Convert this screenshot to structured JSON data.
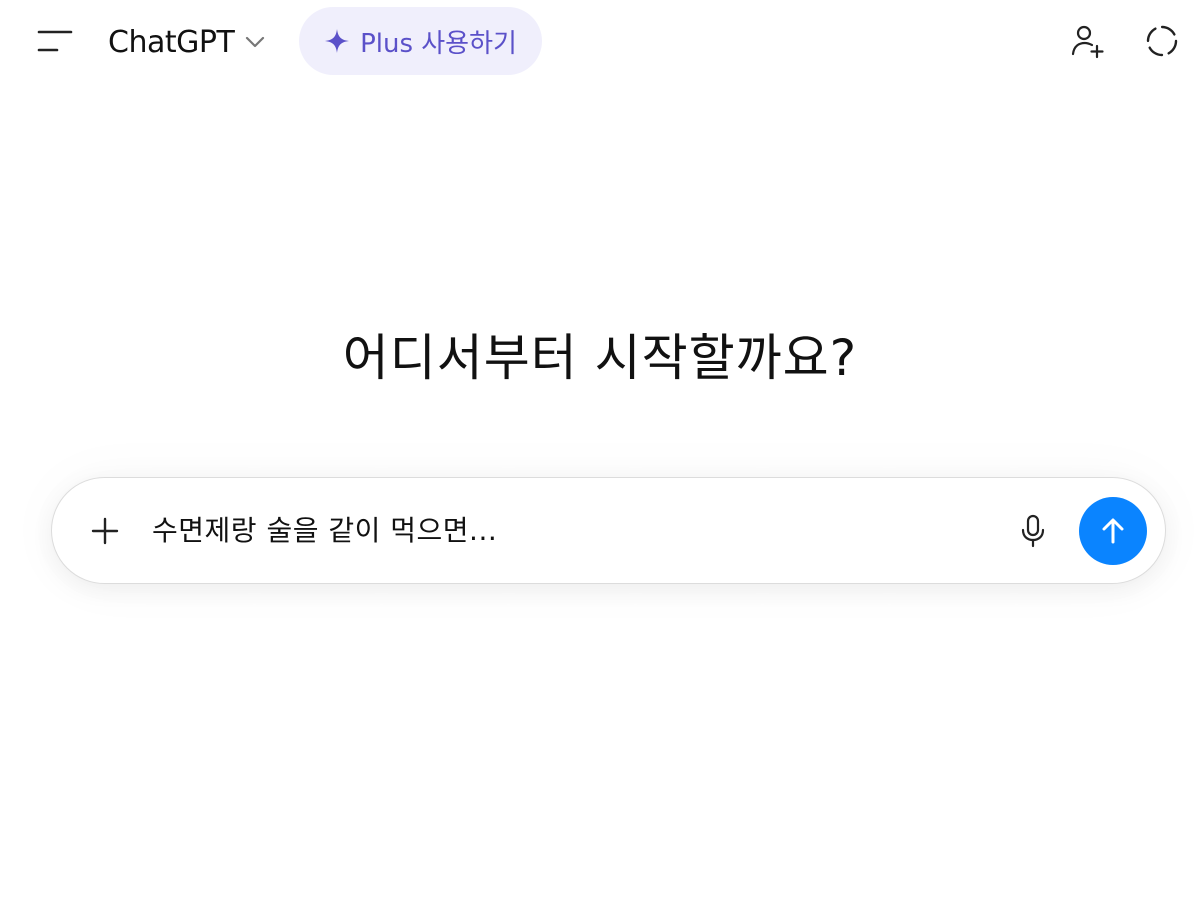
{
  "header": {
    "menu_icon": "sidebar-toggle-icon",
    "model_name": "ChatGPT",
    "model_chevron_icon": "chevron-down-icon",
    "plus_button": {
      "icon": "sparkle-icon",
      "label": "Plus 사용하기",
      "accent_color": "#5b51c9",
      "background_color": "#f0effc"
    },
    "add_user_icon": "add-user-icon",
    "temporary_chat_icon": "temporary-chat-icon"
  },
  "main": {
    "heading": "어디서부터 시작할까요?"
  },
  "composer": {
    "attach_icon": "plus-icon",
    "text": "수면제랑 술을 같이 먹으면...",
    "mic_icon": "microphone-icon",
    "send_icon": "arrow-up-icon",
    "send_color": "#0a84ff"
  }
}
